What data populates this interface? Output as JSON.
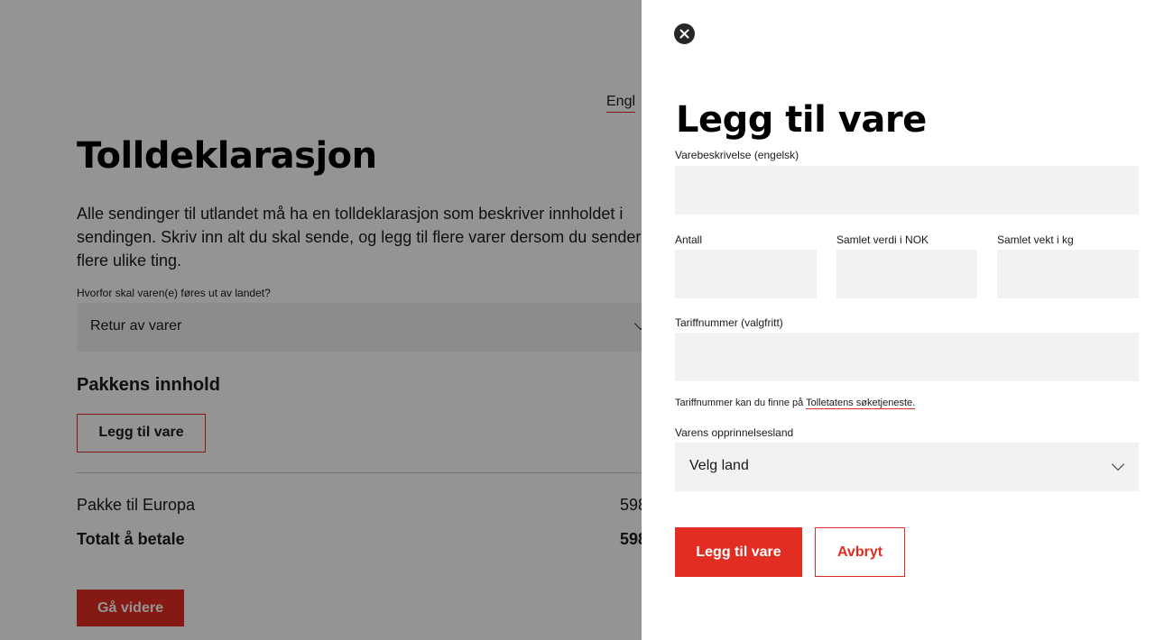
{
  "page": {
    "language_link": "Engl",
    "title": "Tolldeklarasjon",
    "intro_line1": "Alle sendinger til utlandet må ha en tolldeklarasjon som beskriver innholdet i",
    "intro_line2": "sendingen. Skriv inn alt du skal sende, og legg til flere varer dersom du sender",
    "intro_line3": "flere ulike ting.",
    "reason_label": "Hvorfor skal varen(e) føres ut av landet?",
    "reason_value": "Retur av varer",
    "contents_heading": "Pakkens innhold",
    "add_item_button": "Legg til vare",
    "package_label": "Pakke til Europa",
    "package_price": "598",
    "total_label": "Totalt å betale",
    "total_price": "598",
    "continue_button": "Gå videre"
  },
  "drawer": {
    "title": "Legg til vare",
    "description_label": "Varebeskrivelse (engelsk)",
    "description_value": "",
    "quantity_label": "Antall",
    "quantity_value": "",
    "value_label": "Samlet verdi i NOK",
    "value_value": "",
    "weight_label": "Samlet vekt i kg",
    "weight_value": "",
    "tariff_label": "Tariffnummer (valgfritt)",
    "tariff_value": "",
    "tariff_note": "Tariffnummer kan du finne på",
    "tariff_link": "Tolletatens søketjeneste.",
    "origin_label": "Varens opprinnelsesland",
    "origin_value": "Velg land",
    "submit_button": "Legg til vare",
    "cancel_button": "Avbryt"
  },
  "icons": {
    "close": "close-icon",
    "chevron": "chevron-down-icon"
  },
  "colors": {
    "accent": "#e32d22",
    "field_bg": "#f2f2f2",
    "overlay": "rgba(0,0,0,0.42)"
  }
}
